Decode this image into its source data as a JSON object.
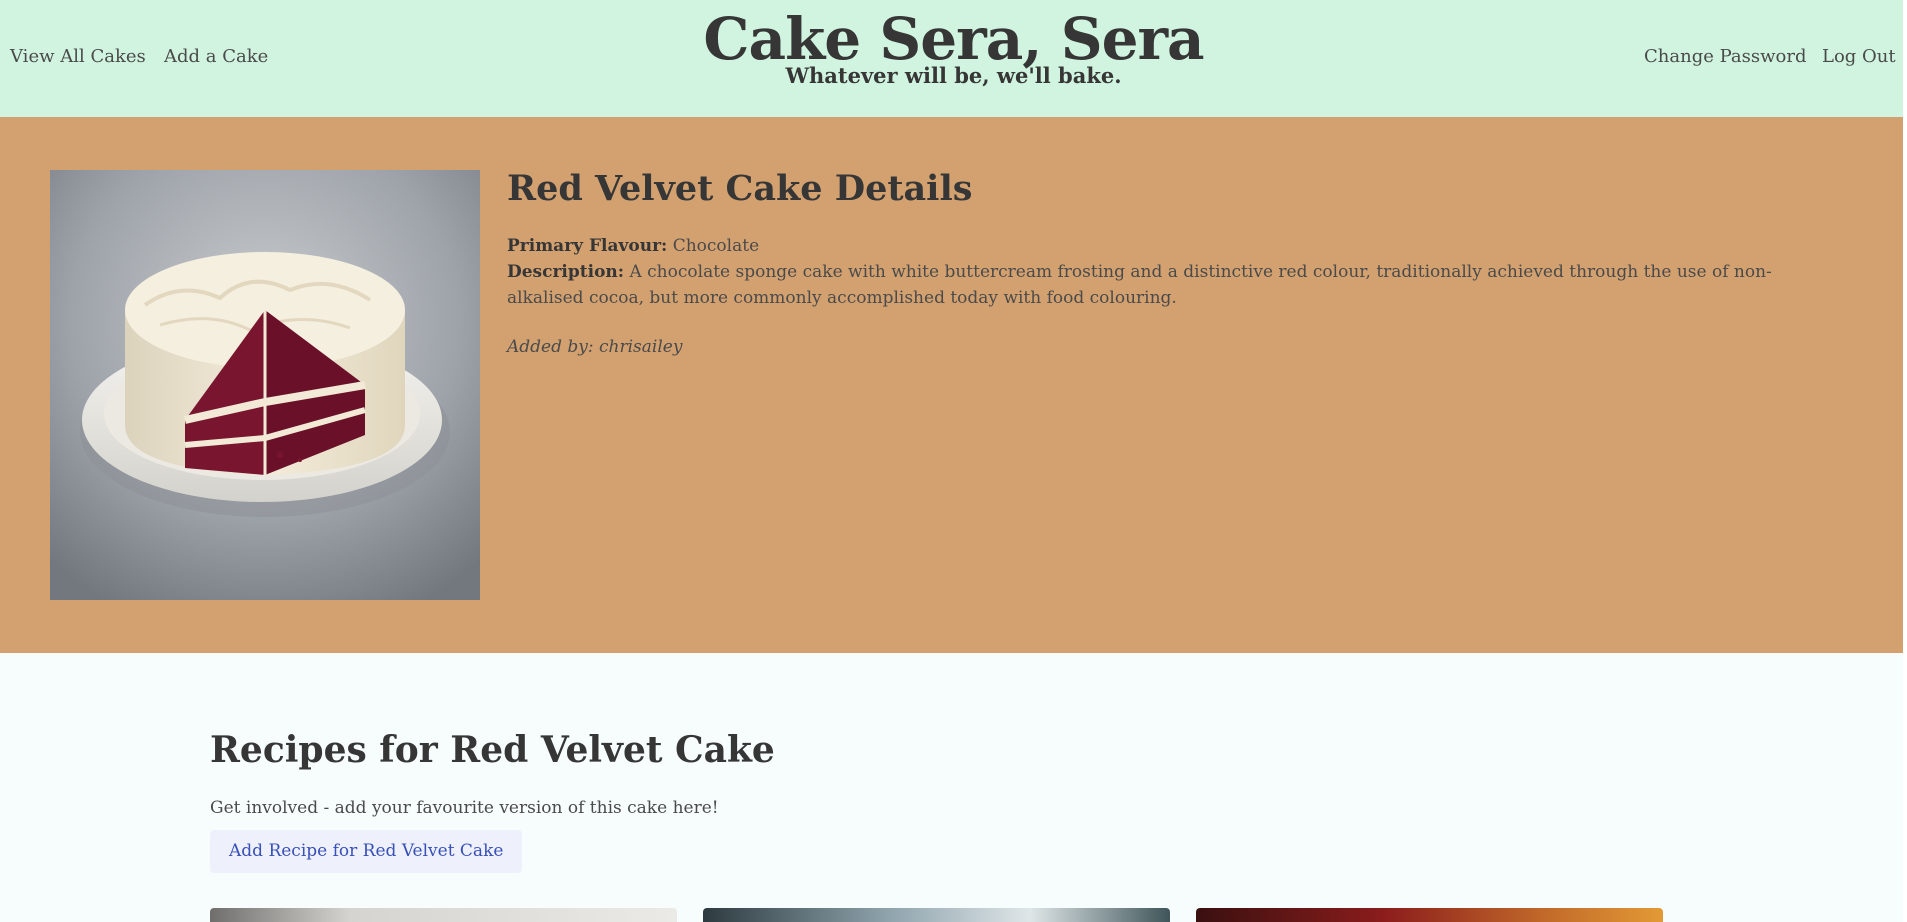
{
  "nav": {
    "left": [
      "View All Cakes",
      "Add a Cake"
    ],
    "right": [
      "Change Password",
      "Log Out"
    ]
  },
  "brand": {
    "title": "Cake Sera, Sera",
    "tagline": "Whatever will be, we'll bake."
  },
  "cake": {
    "title": "Red Velvet Cake Details",
    "primary_flavour_label": "Primary Flavour:",
    "primary_flavour": "Chocolate",
    "description_label": "Description:",
    "description": "A chocolate sponge cake with white buttercream frosting and a distinctive red colour, traditionally achieved through the use of non-alkalised cocoa, but more commonly accomplished today with food colouring.",
    "added_by": "Added by: chrisailey",
    "image_icon": "cake-photo"
  },
  "recipes": {
    "title": "Recipes for Red Velvet Cake",
    "intro": "Get involved - add your favourite version of this cake here!",
    "add_button": "Add Recipe for Red Velvet Cake"
  },
  "colors": {
    "header_bg": "#d1f4e0",
    "hero_bg": "#d3a170",
    "page_bg": "#f6fdfc",
    "button_bg": "#eef0fb",
    "button_text": "#3850b7"
  }
}
